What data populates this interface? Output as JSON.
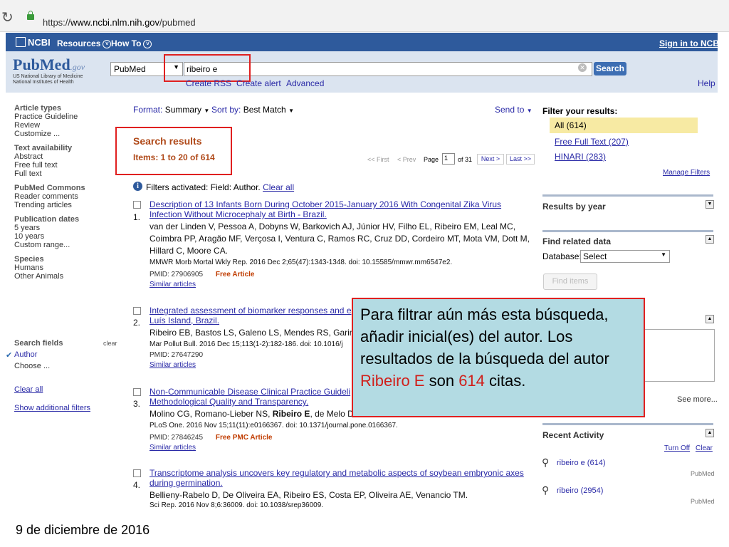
{
  "browser": {
    "url_prefix": "https://",
    "url_host": "www.ncbi.nlm.nih.gov",
    "url_path": "/pubmed"
  },
  "ncbi_bar": {
    "logo": "NCBI",
    "resources": "Resources",
    "howto": "How To",
    "signin": "Sign in to NCBI"
  },
  "header": {
    "logo_pub": "Pub",
    "logo_med": "Med",
    "logo_gov": ".gov",
    "nlm_line1": "US National Library of Medicine",
    "nlm_line2": "National Institutes of Health",
    "db_value": "PubMed",
    "search_value": "ribeiro e",
    "search_button": "Search",
    "create_rss": "Create RSS",
    "create_alert": "Create alert",
    "advanced": "Advanced",
    "help": "Help"
  },
  "sidebar": {
    "groups": [
      {
        "heading": "Article types",
        "items": [
          "Practice Guideline",
          "Review",
          "Customize ..."
        ]
      },
      {
        "heading": "Text availability",
        "items": [
          "Abstract",
          "Free full text",
          "Full text"
        ]
      },
      {
        "heading": "PubMed Commons",
        "items": [
          "Reader comments",
          "Trending articles"
        ]
      },
      {
        "heading": "Publication dates",
        "items": [
          "5 years",
          "10 years",
          "Custom range..."
        ]
      },
      {
        "heading": "Species",
        "items": [
          "Humans",
          "Other Animals"
        ]
      }
    ],
    "search_fields": "Search fields",
    "clear": "clear",
    "author": "Author",
    "choose": "Choose ...",
    "clear_all": "Clear all",
    "show_additional": "Show additional filters"
  },
  "toolbar": {
    "format_label": "Format:",
    "format_value": "Summary",
    "sort_label": "Sort by:",
    "sort_value": "Best Match",
    "send_to": "Send to"
  },
  "results_header": {
    "title": "Search results",
    "items": "Items: 1 to 20 of 614",
    "first": "<< First",
    "prev": "< Prev",
    "page_label": "Page",
    "page_value": "1",
    "of": "of 31",
    "next": "Next >",
    "last": "Last >>"
  },
  "filters_activated": {
    "text": "Filters activated: Field: Author.",
    "clear_all": "Clear all"
  },
  "results": [
    {
      "num": "1.",
      "title1": "Description of 13 Infants Born During October 2015-January 2016 With Congenital Zika Virus",
      "title2": "Infection Without Microcephaly at Birth - Brazil.",
      "authors1": "van der Linden V, Pessoa A, Dobyns W, Barkovich AJ, Júnior HV, Filho EL, Ribeiro EM, Leal MC,",
      "authors2": "Coimbra PP, Aragão MF, Verçosa I, Ventura C, Ramos RC, Cruz DD, Cordeiro MT, Mota VM, Dott M,",
      "authors3": "Hillard C, Moore CA.",
      "journal": "MMWR Morb Mortal Wkly Rep. 2016 Dec 2;65(47):1343-1348. doi: 10.15585/mmwr.mm6547e2.",
      "pmid": "PMID: 27906905",
      "free": "Free Article",
      "similar": "Similar articles"
    },
    {
      "num": "2.",
      "title1": "Integrated assessment of biomarker responses and e",
      "title2": "Luís Island, Brazil.",
      "authors1": "Ribeiro EB, Bastos LS, Galeno LS, Mendes RS, Garin",
      "journal": "Mar Pollut Bull. 2016 Dec 15;113(1-2):182-186. doi: 10.1016/j",
      "pmid": "PMID: 27647290",
      "similar": "Similar articles"
    },
    {
      "num": "3.",
      "title1": "Non-Communicable Disease Clinical Practice Guideli",
      "title2": "Methodological Quality and Transparency.",
      "authors_pre": "Molino CG, Romano-Lieber NS,",
      "authors_bold": "Ribeiro E",
      "authors_post": ", de Melo DO.",
      "journal": "PLoS One. 2016 Nov 15;11(11):e0166367. doi: 10.1371/journal.pone.0166367.",
      "pmid": "PMID: 27846245",
      "free": "Free PMC Article",
      "similar": "Similar articles"
    },
    {
      "num": "4.",
      "title1": "Transcriptome analysis uncovers key regulatory and metabolic aspects of soybean embryonic axes",
      "title2": "during germination.",
      "authors1": "Bellieny-Rabelo D, De Oliveira EA, Ribeiro ES, Costa EP, Oliveira AE, Venancio TM.",
      "journal": "Sci Rep. 2016 Nov 8;6:36009. doi: 10.1038/srep36009."
    }
  ],
  "right": {
    "filter_title": "Filter your results:",
    "all": "All (614)",
    "free_full": "Free Full Text (207)",
    "hinari": "HINARI (283)",
    "manage": "Manage Filters",
    "results_by_year": "Results by year",
    "find_related": "Find related data",
    "database_label": "Database:",
    "database_value": "Select",
    "find_items": "Find items",
    "see_more": "See more...",
    "recent_activity": "Recent Activity",
    "turn_off": "Turn Off",
    "clear": "Clear",
    "recent": [
      {
        "query": "ribeiro e (614)",
        "db": "PubMed"
      },
      {
        "query": "ribeiro (2954)",
        "db": "PubMed"
      }
    ]
  },
  "callout": {
    "text_pre": "Para filtrar aún más esta búsqueda, añadir inicial(es) del autor. Los resultados de la búsqueda del autor ",
    "name": "Ribeiro E",
    "text_mid": " son ",
    "count": "614",
    "text_post": " citas."
  },
  "footer": "9 de diciembre de 2016",
  "colors": {
    "accent_red": "#e02020",
    "callout_bg": "#b3dbe3",
    "ncbi_blue": "#2e5a9c"
  }
}
